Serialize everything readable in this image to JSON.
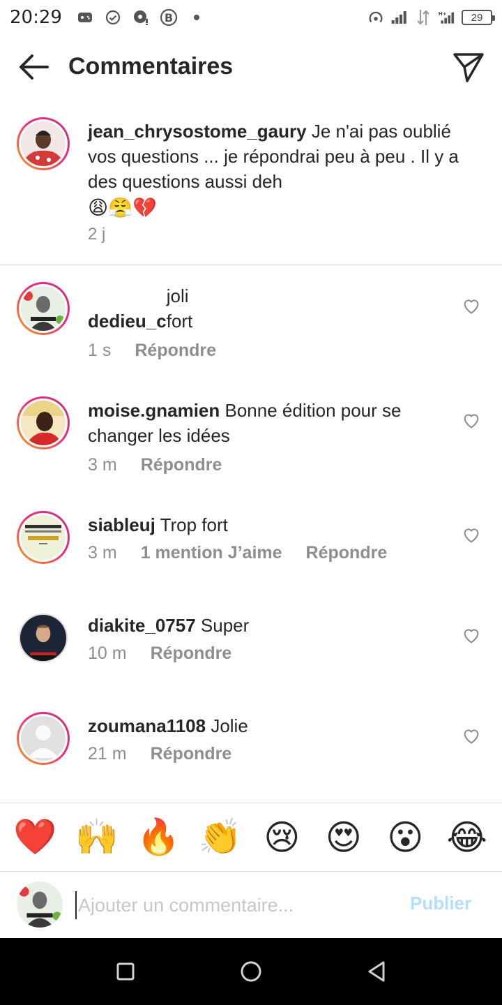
{
  "status_bar": {
    "time": "20:29",
    "battery": "29"
  },
  "header": {
    "title": "Commentaires",
    "back_icon": "arrow-left-icon",
    "send_icon": "paper-plane-icon"
  },
  "caption": {
    "username": "jean_chrysostome_gaury",
    "text": " Je n'ai pas oublié vos questions ... je répondrai peu à peu . Il y a des questions aussi deh",
    "emojis": "😩😤💔",
    "time": "2 j"
  },
  "comments": [
    {
      "username": "dedieu_c",
      "text": " joli fort",
      "time": "1 s",
      "likes": "",
      "reply": "Répondre"
    },
    {
      "username": "moise.gnamien",
      "text": " Bonne édition pour se changer les idées",
      "time": "3 m",
      "likes": "",
      "reply": "Répondre"
    },
    {
      "username": "siableuj",
      "text": " Trop fort",
      "time": "3 m",
      "likes": "1 mention J’aime",
      "reply": "Répondre"
    },
    {
      "username": "diakite_0757",
      "text": " Super",
      "time": "10 m",
      "likes": "",
      "reply": "Répondre"
    },
    {
      "username": "zoumana1108",
      "text": " Jolie",
      "time": "21 m",
      "likes": "",
      "reply": "Répondre"
    }
  ],
  "emoji_bar": [
    "❤️",
    "🙌",
    "🔥",
    "👏",
    "😢",
    "😍",
    "😮",
    "😂"
  ],
  "input": {
    "placeholder": "Ajouter un commentaire...",
    "publish_label": "Publier"
  },
  "colors": {
    "accent_disabled": "#b2dffc",
    "secondary_text": "#8e8e8e",
    "divider": "#dbdbdb"
  }
}
